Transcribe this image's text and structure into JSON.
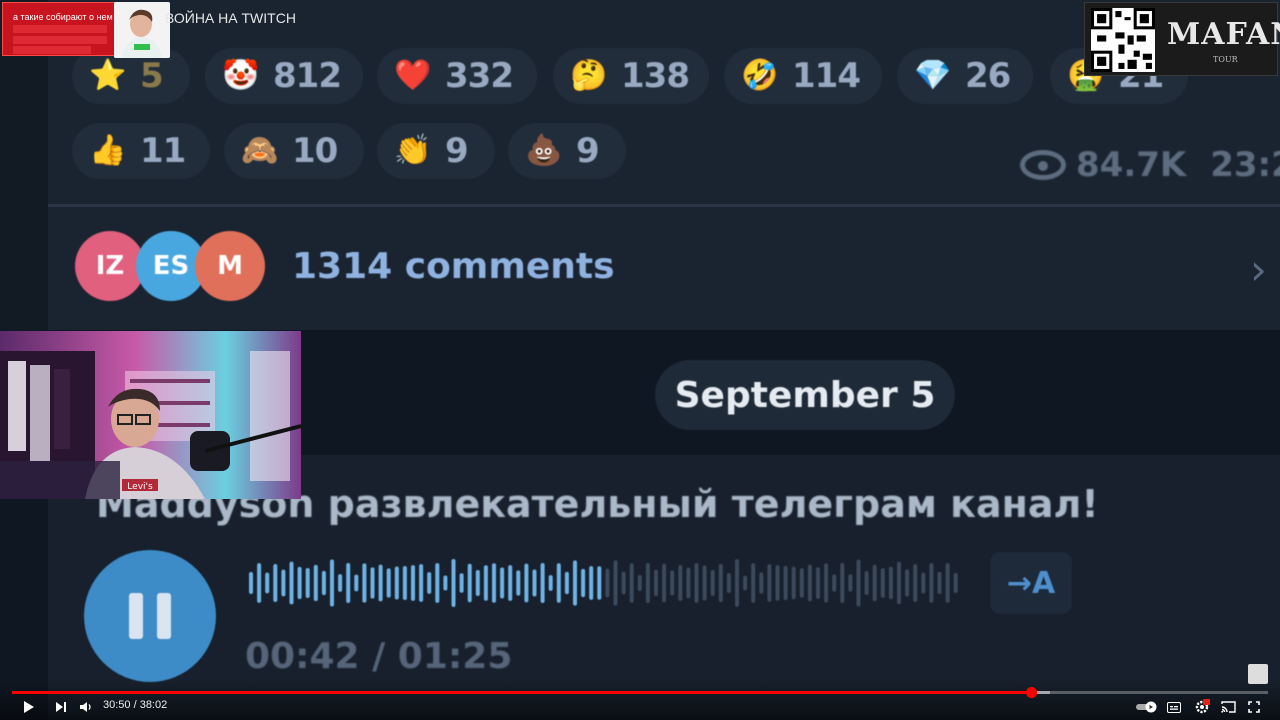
{
  "video": {
    "title": "ВОЙНА НА TWITCH",
    "time_current": "30:50",
    "time_total": "38:02",
    "time_display": "30:50 / 38:02",
    "progress_fraction": 0.811
  },
  "overlays": {
    "top_left_banner_text": "а такие собирают о нем",
    "qr_brand": "MAFANYA",
    "qr_subtext": "TOUR"
  },
  "telegram": {
    "reactions_row1": [
      {
        "icon": "star-emoji-icon",
        "glyph": "⭐",
        "count": "5"
      },
      {
        "icon": "clown-emoji-icon",
        "glyph": "🤡",
        "count": "812"
      },
      {
        "icon": "heart-emoji-icon",
        "glyph": "❤️",
        "count": "332"
      },
      {
        "icon": "thinking-emoji-icon",
        "glyph": "🤔",
        "count": "138"
      },
      {
        "icon": "laughing-emoji-icon",
        "glyph": "🤣",
        "count": "114"
      },
      {
        "icon": "diamond-emoji-icon",
        "glyph": "💎",
        "count": "26"
      },
      {
        "icon": "green-emoji-icon",
        "glyph": "🤮",
        "count": "21"
      }
    ],
    "reactions_row2": [
      {
        "icon": "thumbs-up-emoji-icon",
        "glyph": "👍",
        "count": "11"
      },
      {
        "icon": "monkey-emoji-icon",
        "glyph": "🙈",
        "count": "10"
      },
      {
        "icon": "clap-emoji-icon",
        "glyph": "👏",
        "count": "9"
      },
      {
        "icon": "poop-emoji-icon",
        "glyph": "💩",
        "count": "9"
      }
    ],
    "views": "84.7K",
    "post_time": "23:2",
    "commenters": [
      {
        "initials": "IZ",
        "color": "#e0607e"
      },
      {
        "initials": "ES",
        "color": "#49a7df"
      },
      {
        "initials": "M",
        "color": "#e0705a"
      }
    ],
    "comments_label": "1314 comments",
    "date_separator": "September 5",
    "message_caption": "Maddyson  развлекательный телеграм канал!",
    "voice_time": "00:42 / 01:25",
    "voice_progress_fraction": 0.5,
    "translate_label": "→A"
  }
}
